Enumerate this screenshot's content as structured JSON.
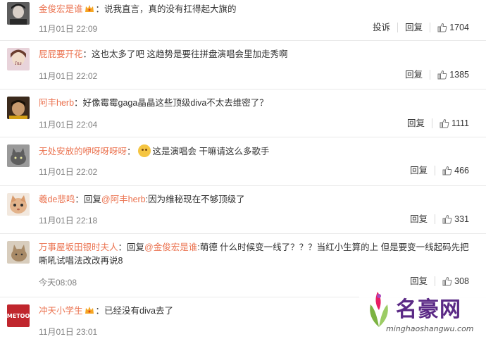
{
  "comments": [
    {
      "user": "金俊宏是谁",
      "content": "：说我直言，真的没有扛得起大旗的",
      "time": "11月01日 22:09",
      "report": "投诉",
      "reply": "回复",
      "likes": "1704",
      "avatar_color": "#888888"
    },
    {
      "user": "屁屁要开花",
      "content": "：这也太多了吧 这趋势是要往拼盘演唱会里加走秀啊",
      "time": "11月01日 22:02",
      "reply": "回复",
      "likes": "1385",
      "avatar_color": "#c9a7b4"
    },
    {
      "user": "阿丰herb",
      "content": "：好像霉霉gaga晶晶这些顶级diva不太去维密了？",
      "time": "11月01日 22:04",
      "reply": "回复",
      "likes": "1111",
      "avatar_color": "#6b4a2b"
    },
    {
      "user": "无处安放的咿呀呀呀呀",
      "content_a": "：",
      "content_b": "这是演唱会 干嘛请这么多歌手",
      "time": "11月01日 22:02",
      "reply": "回复",
      "likes": "466",
      "avatar_color": "#7a7a7a"
    },
    {
      "user": "羲de悲鸣",
      "reply_prefix": "：回复",
      "mention": "@阿丰herb",
      "content": ":因为维秘现在不够顶级了",
      "time": "11月01日 22:18",
      "reply": "回复",
      "likes": "331",
      "avatar_color": "#d9a27a"
    },
    {
      "user": "万事屋坂田银时夫人",
      "reply_prefix": "：回复",
      "mention": "@金俊宏是谁",
      "content": ":萌德 什么时候变一线了？？？当红小生算的上 但是要变一线起码先把嘶吼试唱法改改再说8",
      "time": "今天08:08",
      "reply": "回复",
      "likes": "308",
      "avatar_color": "#b8a48a"
    },
    {
      "user": "冲天小学生",
      "content": "：已经没有diva去了",
      "time": "11月01日 23:01",
      "avatar_color": "#c0262d",
      "avatar_text": "METOO"
    }
  ],
  "watermark": {
    "brand": "名豪网",
    "url": "minghaoshangwu.com"
  },
  "colors": {
    "username": "#eb7350",
    "meta": "#808080",
    "badge": "#f5a623"
  }
}
